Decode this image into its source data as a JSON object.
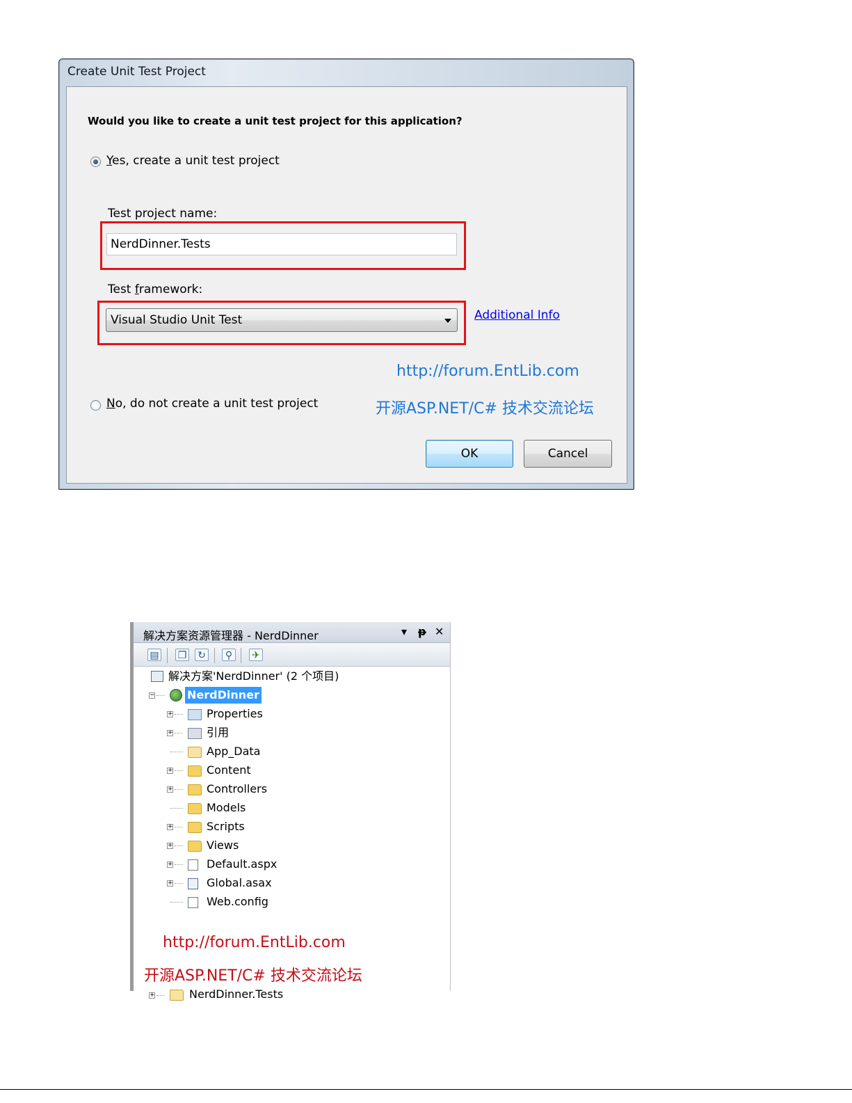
{
  "dialog": {
    "title": "Create Unit Test Project",
    "question": "Would you like to create a unit test project for this application?",
    "yes_option": {
      "mnemonic": "Y",
      "rest": "es, create a unit test project",
      "checked": true
    },
    "project_name_label": "Test project name:",
    "project_name_value": "NerdDinner.Tests",
    "framework_label": {
      "before": "Test ",
      "mnemonic": "f",
      "after": "ramework:"
    },
    "framework_selected": "Visual Studio Unit Test",
    "additional_info_link": "Additional Info",
    "no_option": {
      "mnemonic": "N",
      "rest": "o, do not create a unit test project",
      "checked": false
    },
    "ok_label": "OK",
    "cancel_label": "Cancel",
    "watermark_url": "http://forum.EntLib.com",
    "watermark_text": "开源ASP.NET/C# 技术交流论坛"
  },
  "explorer": {
    "title": "解决方案资源管理器 - NerdDinner",
    "dropdown_glyph": "▾",
    "pin_glyph": "ᵽ",
    "close_glyph": "✕",
    "solution_label": "解决方案'NerdDinner' (2 个项目)",
    "project_label": "NerdDinner",
    "items": [
      {
        "label": "Properties",
        "icon": "properties-folder-icon",
        "expandable": true
      },
      {
        "label": "引用",
        "icon": "references-icon",
        "expandable": true
      },
      {
        "label": "App_Data",
        "icon": "app-data-folder-icon",
        "expandable": false
      },
      {
        "label": "Content",
        "icon": "folder-icon",
        "expandable": true
      },
      {
        "label": "Controllers",
        "icon": "folder-icon",
        "expandable": true
      },
      {
        "label": "Models",
        "icon": "folder-icon",
        "expandable": false
      },
      {
        "label": "Scripts",
        "icon": "folder-icon",
        "expandable": true
      },
      {
        "label": "Views",
        "icon": "folder-icon",
        "expandable": true
      },
      {
        "label": "Default.aspx",
        "icon": "aspx-page-icon",
        "expandable": true
      },
      {
        "label": "Global.asax",
        "icon": "asax-file-icon",
        "expandable": true
      },
      {
        "label": "Web.config",
        "icon": "config-file-icon",
        "expandable": false
      }
    ],
    "tests_project_label": "NerdDinner.Tests",
    "watermark_url": "http://forum.EntLib.com",
    "watermark_text": "开源ASP.NET/C# 技术交流论坛"
  },
  "colors": {
    "highlight_box": "#e3131b",
    "watermark_blue": "#1f77d6",
    "watermark_red": "#c4101a",
    "selection": "#3399ff",
    "link": "#0000ee"
  }
}
